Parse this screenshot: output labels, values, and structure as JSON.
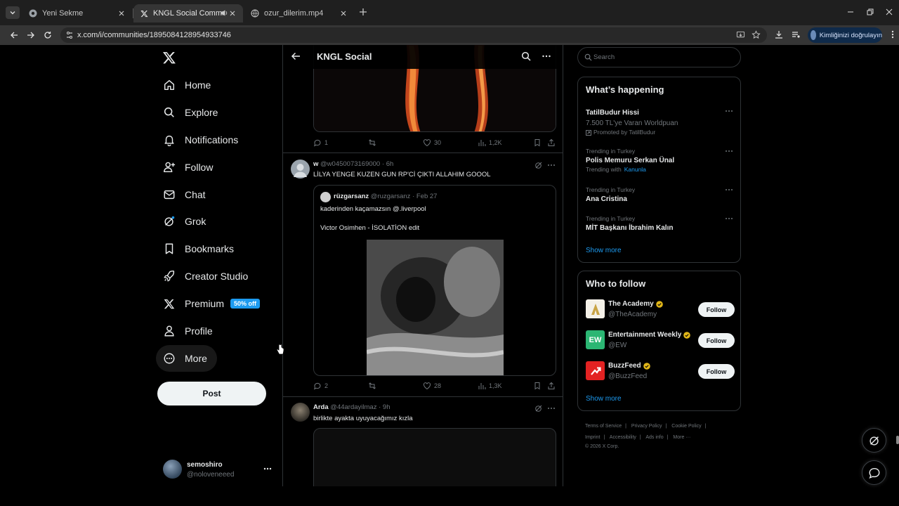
{
  "browser": {
    "tabs": [
      {
        "title": "Yeni Sekme",
        "favicon": "chrome-icon",
        "active": false
      },
      {
        "title": "KNGL Social Community / X",
        "favicon": "x-logo-icon",
        "active": true,
        "audio": true
      },
      {
        "title": "ozur_dilerim.mp4",
        "favicon": "globe-icon",
        "active": false
      }
    ],
    "url": "x.com/i/communities/1895084128954933746",
    "profile_chip": "Kimliğinizi doğrulayın"
  },
  "nav": {
    "items": [
      {
        "label": "Home",
        "icon": "home-icon"
      },
      {
        "label": "Explore",
        "icon": "search-icon"
      },
      {
        "label": "Notifications",
        "icon": "bell-icon"
      },
      {
        "label": "Follow",
        "icon": "person-plus-icon"
      },
      {
        "label": "Chat",
        "icon": "mail-icon"
      },
      {
        "label": "Grok",
        "icon": "grok-icon"
      },
      {
        "label": "Bookmarks",
        "icon": "bookmark-icon"
      },
      {
        "label": "Creator Studio",
        "icon": "rocket-icon"
      },
      {
        "label": "Premium",
        "icon": "x-logo-icon",
        "badge": "50% off"
      },
      {
        "label": "Profile",
        "icon": "person-icon"
      },
      {
        "label": "More",
        "icon": "more-circle-icon"
      }
    ],
    "post_label": "Post",
    "account": {
      "name": "semoshiro",
      "handle": "@noloveneeed"
    }
  },
  "main": {
    "title": "KNGL Social",
    "posts": [
      {
        "stats": {
          "replies": "1",
          "reposts": "",
          "likes": "30",
          "views": "1,2K"
        }
      },
      {
        "name": "w",
        "handle": "@w0450073169000",
        "time": "6h",
        "text": "LİLYA YENGE KUZEN GUN RP'Cİ ÇIKTI ALLAHIM GOOOL",
        "quote": {
          "name": "rüzgarsanz",
          "handle": "@ruzgarsanz",
          "date": "Feb 27",
          "line1": "kaderinden kaçamazsın @.liverpool",
          "line2": "Victor Osimhen - İSOLATİON edit"
        },
        "stats": {
          "replies": "2",
          "reposts": "",
          "likes": "28",
          "views": "1,3K"
        }
      },
      {
        "name": "Arda",
        "handle": "@44ardayilmaz",
        "time": "9h",
        "text": "birlikte ayakta uyuyacağımız kızla"
      }
    ]
  },
  "right": {
    "search_placeholder": "Search",
    "happening": {
      "title": "What’s happening",
      "trends": [
        {
          "title": "TatilBudur Hissi",
          "sub": "7.500 TL'ye Varan Worldpuan",
          "promo": "Promoted by TatilBudur"
        },
        {
          "context": "Trending in Turkey",
          "title": "Polis Memuru Serkan Ünal",
          "with_label": "Trending with",
          "with_link": "Kanunla"
        },
        {
          "context": "Trending in Turkey",
          "title": "Ana Cristina"
        },
        {
          "context": "Trending in Turkey",
          "title": "MİT Başkanı İbrahim Kalın"
        }
      ],
      "show_more": "Show more"
    },
    "who_to_follow": {
      "title": "Who to follow",
      "accounts": [
        {
          "name": "The Academy",
          "handle": "@TheAcademy",
          "avatar_text": "",
          "avatar_bg": "#f4f1e8"
        },
        {
          "name": "Entertainment Weekly",
          "handle": "@EW",
          "avatar_text": "EW",
          "avatar_bg": "#2bb673"
        },
        {
          "name": "BuzzFeed",
          "handle": "@BuzzFeed",
          "avatar_text": "",
          "avatar_bg": "#e32"
        }
      ],
      "follow_label": "Follow",
      "show_more": "Show more"
    },
    "footer": {
      "links": [
        "Terms of Service",
        "Privacy Policy",
        "Cookie Policy",
        "Imprint",
        "Accessibility",
        "Ads info",
        "More ···"
      ],
      "copyright": "© 2026 X Corp."
    }
  },
  "colors": {
    "accent": "#1d9bf0",
    "verified": "#f4b400",
    "border": "#2f3336"
  }
}
